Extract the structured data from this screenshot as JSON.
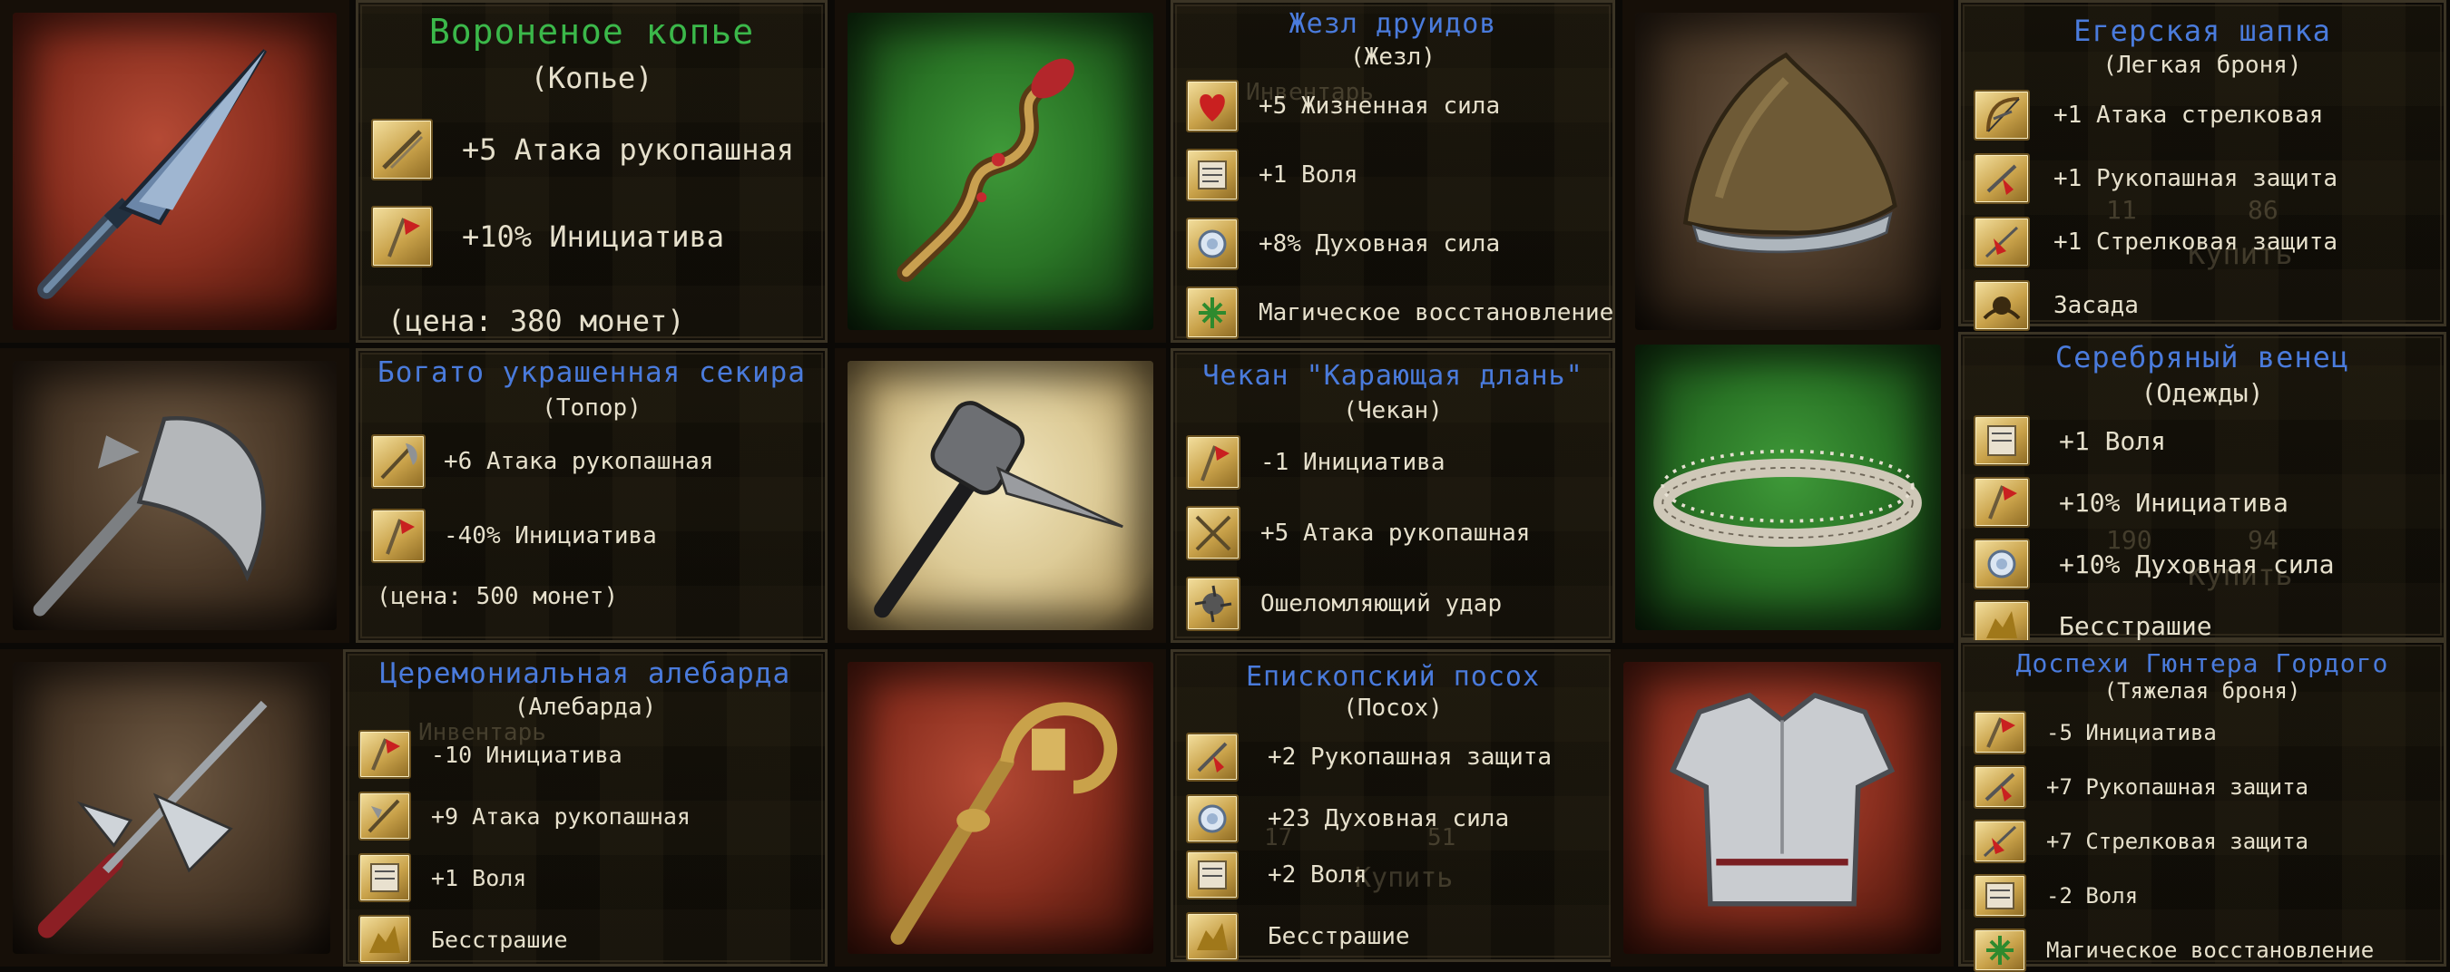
{
  "items": [
    {
      "title": "Вороненое копье",
      "type": "(Копье)",
      "stats": [
        "+5 Атака рукопашная",
        "+10% Инициатива"
      ],
      "price": "(цена: 380 монет)"
    },
    {
      "title": "Жезл друидов",
      "type": "(Жезл)",
      "stats": [
        "+5 Жизненная сила",
        "+1 Воля",
        "+8% Духовная сила",
        "Магическое восстановление"
      ]
    },
    {
      "title": "Егерская шапка",
      "type": "(Легкая броня)",
      "stats": [
        "+1 Атака стрелковая",
        "+1 Рукопашная защита",
        "+1 Стрелковая защита",
        "Засада"
      ]
    },
    {
      "title": "Богато украшенная секира",
      "type": "(Топор)",
      "stats": [
        "+6 Атака рукопашная",
        "-40% Инициатива"
      ],
      "price": "(цена: 500 монет)"
    },
    {
      "title": "Чекан \"Карающая длань\"",
      "type": "(Чекан)",
      "stats": [
        "-1 Инициатива",
        "+5 Атака рукопашная",
        "Ошеломляющий удар"
      ]
    },
    {
      "title": "Серебряный венец",
      "type": "(Одежды)",
      "stats": [
        "+1 Воля",
        "+10% Инициатива",
        "+10% Духовная сила",
        "Бесстрашие"
      ]
    },
    {
      "title": "Церемониальная алебарда",
      "type": "(Алебарда)",
      "stats": [
        "-10 Инициатива",
        "+9 Атака рукопашная",
        "+1 Воля",
        "Бесстрашие"
      ]
    },
    {
      "title": "Епископский посох",
      "type": "(Посох)",
      "stats": [
        "+2 Рукопашная защита",
        "+23 Духовная сила",
        "+2 Воля",
        "Бесстрашие"
      ]
    },
    {
      "title": "Доспехи Гюнтера Гордого",
      "type": "(Тяжелая броня)",
      "stats": [
        "-5 Инициатива",
        "+7 Рукопашная защита",
        "+7 Стрелковая защита",
        "-2 Воля",
        "Магическое восстановление"
      ]
    }
  ],
  "ghost": {
    "inventory": "Инвентарь",
    "buy": "Купить",
    "n11": "11",
    "n86": "86",
    "n190": "190",
    "n94": "94",
    "n17": "17",
    "n51": "51"
  },
  "colors": {
    "title_green": "#3bb84a",
    "title_blue": "#4a7bdc",
    "text": "#e6e0cc",
    "panel_border": "#3b3425"
  }
}
